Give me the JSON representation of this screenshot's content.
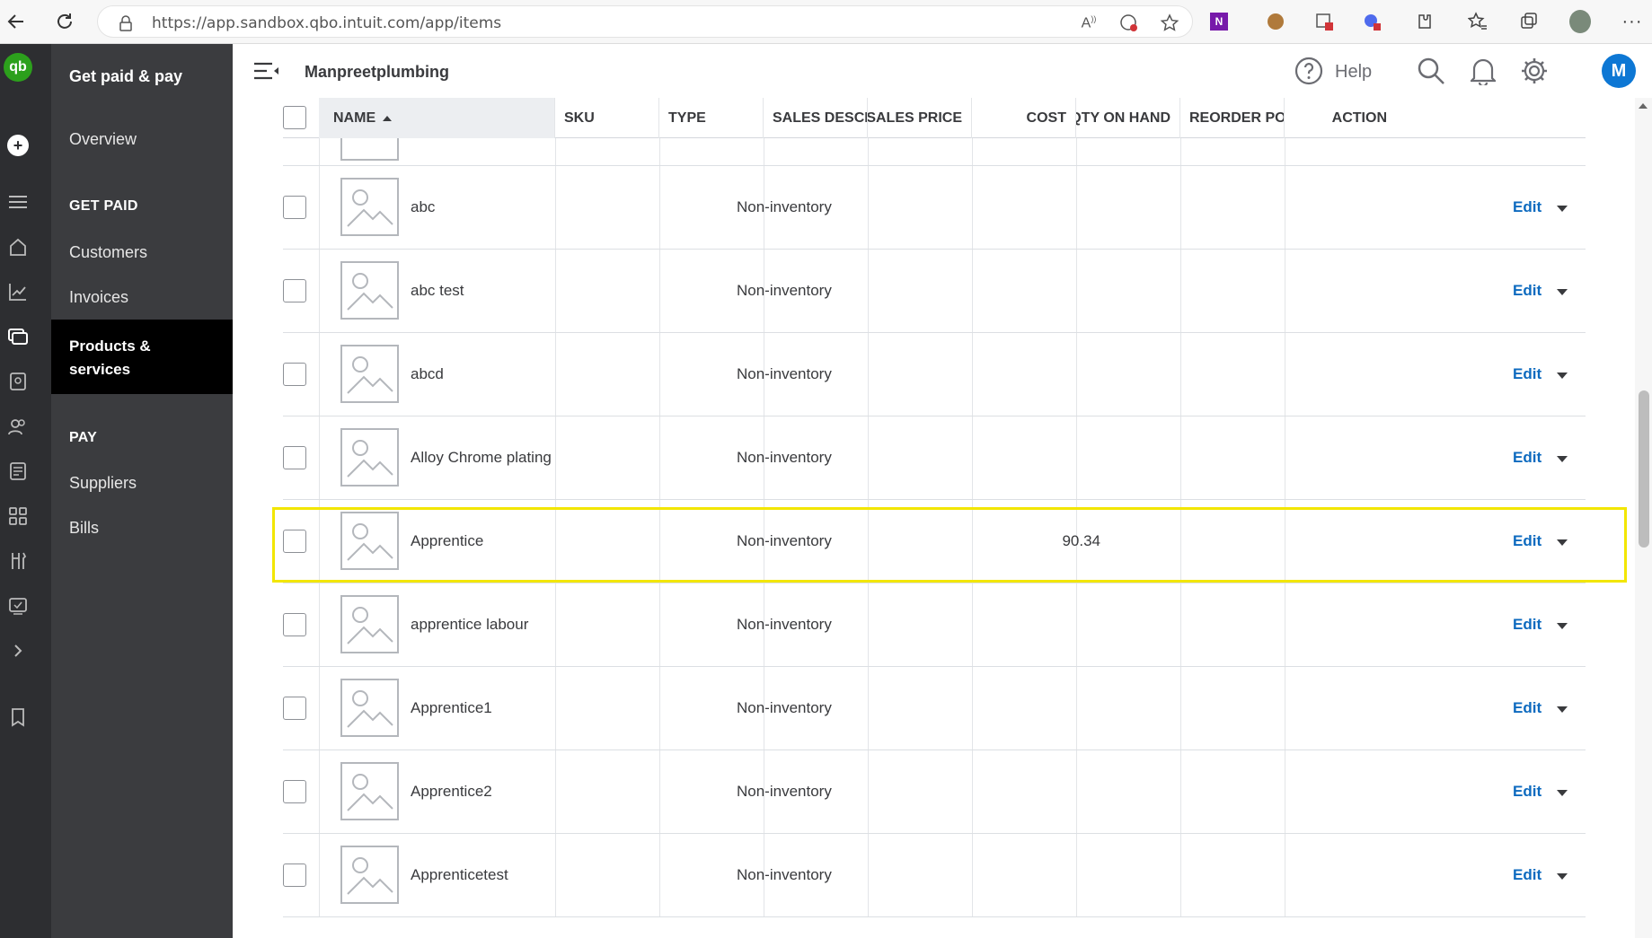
{
  "browser": {
    "url": "https://app.sandbox.qbo.intuit.com/app/items"
  },
  "sidenav": {
    "title": "Get paid & pay",
    "overview": "Overview",
    "get_paid_section": "GET PAID",
    "customers": "Customers",
    "invoices": "Invoices",
    "active_item": "Products & services",
    "pay_section": "PAY",
    "suppliers": "Suppliers",
    "bills": "Bills"
  },
  "header": {
    "company": "Manpreetplumbing",
    "help_label": "Help",
    "avatar_letter": "M"
  },
  "table": {
    "columns": {
      "name": "NAME",
      "sku": "SKU",
      "type": "TYPE",
      "sales_description": "SALES DESCRIPT",
      "sales_price": "SALES PRICE",
      "cost": "COST",
      "qty_on_hand": "QTY ON HAND",
      "reorder_point": "REORDER POINT",
      "action": "ACTION"
    },
    "rows": [
      {
        "name": "abc",
        "type": "Non-inventory",
        "sales_price": "",
        "action": "Edit"
      },
      {
        "name": "abc test",
        "type": "Non-inventory",
        "sales_price": "",
        "action": "Edit"
      },
      {
        "name": "abcd",
        "type": "Non-inventory",
        "sales_price": "",
        "action": "Edit"
      },
      {
        "name": "Alloy Chrome plating",
        "type": "Non-inventory",
        "sales_price": "",
        "action": "Edit"
      },
      {
        "name": "Apprentice",
        "type": "Non-inventory",
        "sales_price": "90.34",
        "action": "Edit"
      },
      {
        "name": "apprentice labour",
        "type": "Non-inventory",
        "sales_price": "",
        "action": "Edit"
      },
      {
        "name": "Apprentice1",
        "type": "Non-inventory",
        "sales_price": "",
        "action": "Edit"
      },
      {
        "name": "Apprentice2",
        "type": "Non-inventory",
        "sales_price": "",
        "action": "Edit"
      },
      {
        "name": "Apprenticetest",
        "type": "Non-inventory",
        "sales_price": "",
        "action": "Edit"
      }
    ]
  },
  "colors": {
    "brand_green": "#2ca01c",
    "highlight": "#f2e600",
    "link_blue": "#0d6abf"
  }
}
